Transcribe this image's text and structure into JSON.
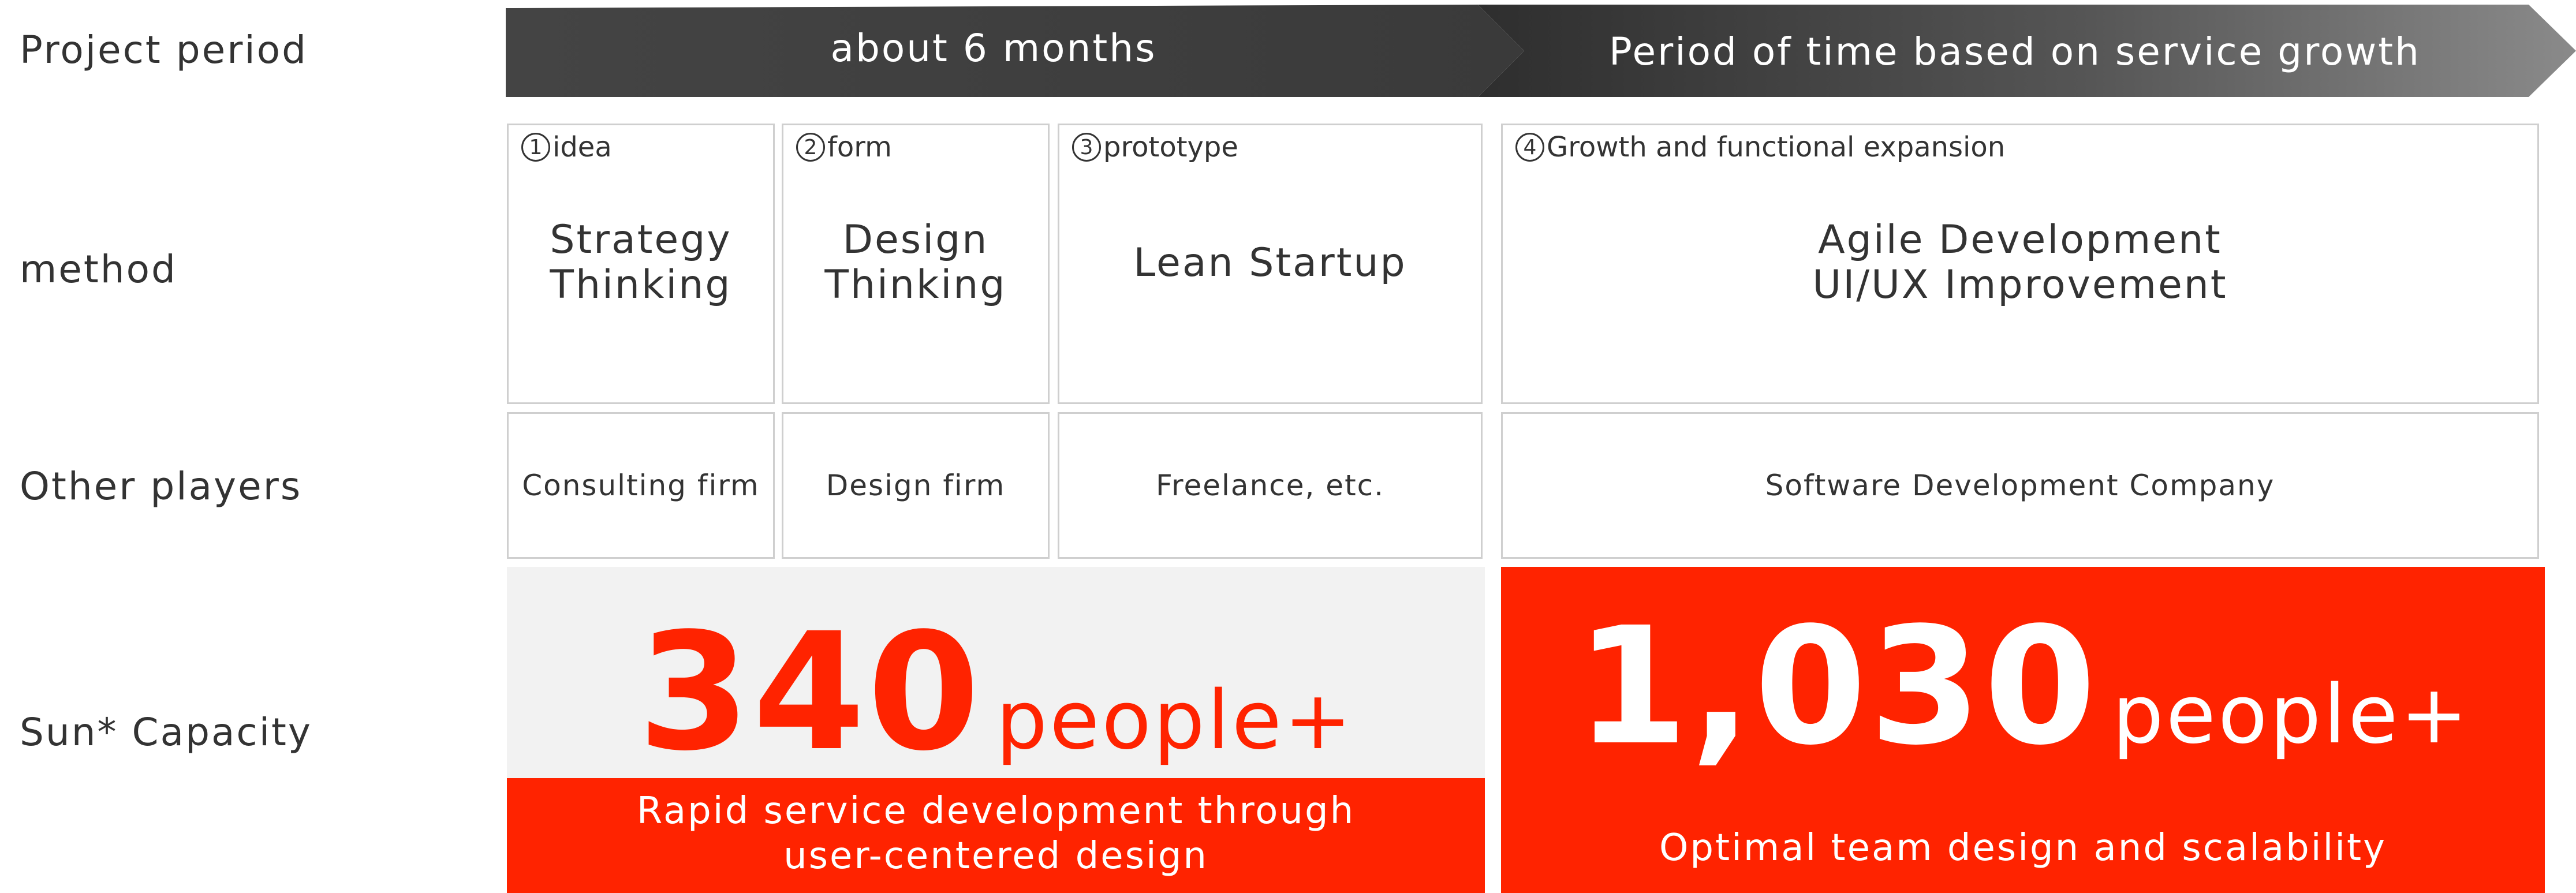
{
  "row_labels": {
    "project_period": "Project period",
    "method": "method",
    "other_players": "Other players",
    "capacity": "Sun* Capacity"
  },
  "period": {
    "left": "about 6 months",
    "right": "Period of time based on service growth"
  },
  "steps": [
    {
      "num": "1",
      "label": "idea",
      "method": "Strategy\nThinking",
      "player": "Consulting firm"
    },
    {
      "num": "2",
      "label": "form",
      "method": "Design\nThinking",
      "player": "Design firm"
    },
    {
      "num": "3",
      "label": "prototype",
      "method": "Lean Startup",
      "player": "Freelance, etc."
    },
    {
      "num": "4",
      "label": "Growth and functional expansion",
      "method": "Agile Development\nUI/UX Improvement",
      "player": "Software Development Company"
    }
  ],
  "capacity": {
    "left": {
      "number": "340",
      "unit": "people+",
      "description": "Rapid service development through\nuser-centered design"
    },
    "right": {
      "number": "1,030",
      "unit": "people+",
      "description": "Optimal team design and scalability"
    }
  },
  "colors": {
    "accent_red": "#ff2300",
    "arrow_dark": "#3a3a3a",
    "arrow_light": "#8a8a8a",
    "panel_gray": "#f2f2f2",
    "border_gray": "#cfcfcf"
  }
}
